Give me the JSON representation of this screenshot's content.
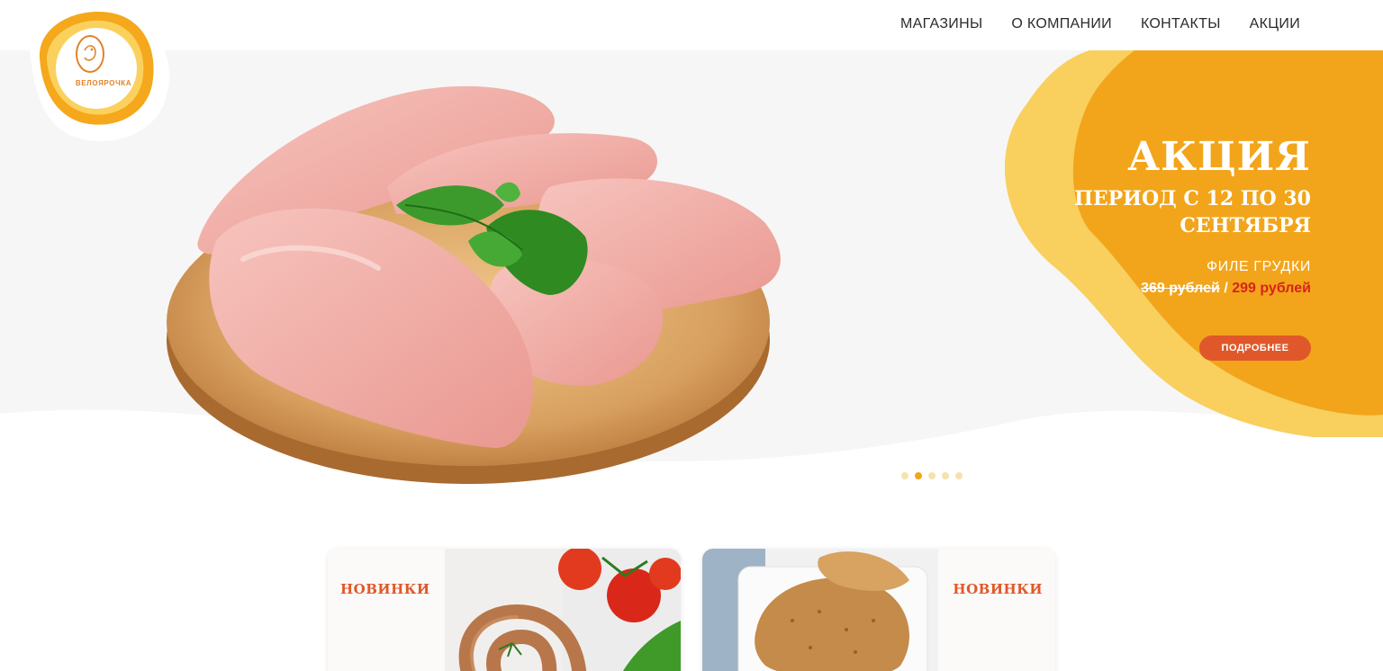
{
  "brand": {
    "logo_text": "ВЕЛОЯРОЧКА"
  },
  "nav": {
    "items": [
      {
        "label": "МАГАЗИНЫ"
      },
      {
        "label": "О КОМПАНИИ"
      },
      {
        "label": "КОНТАКТЫ"
      },
      {
        "label": "АКЦИИ"
      }
    ]
  },
  "promo": {
    "title": "АКЦИЯ",
    "period_line1": "ПЕРИОД С 12 ПО 30",
    "period_line2": "СЕНТЯБРЯ",
    "product": "ФИЛЕ ГРУДКИ",
    "old_price": "369 рублей",
    "price_separator": "/",
    "new_price": "299 рублей",
    "button_label": "ПОДРОБНЕЕ"
  },
  "carousel": {
    "slide_count": 5,
    "active_index": 1
  },
  "cards": [
    {
      "label": "НОВИНКИ",
      "image": "sausage-and-tomatoes-photo"
    },
    {
      "label": "НОВИНКИ",
      "image": "roasted-chicken-photo"
    }
  ],
  "colors": {
    "accent_orange": "#f2a51a",
    "accent_light": "#f9cf5e",
    "button_orange": "#e0582a",
    "price_red": "#d8231c",
    "card_label": "#e0582a"
  },
  "icons": {
    "logo": "chicken-egg-logo-icon"
  }
}
